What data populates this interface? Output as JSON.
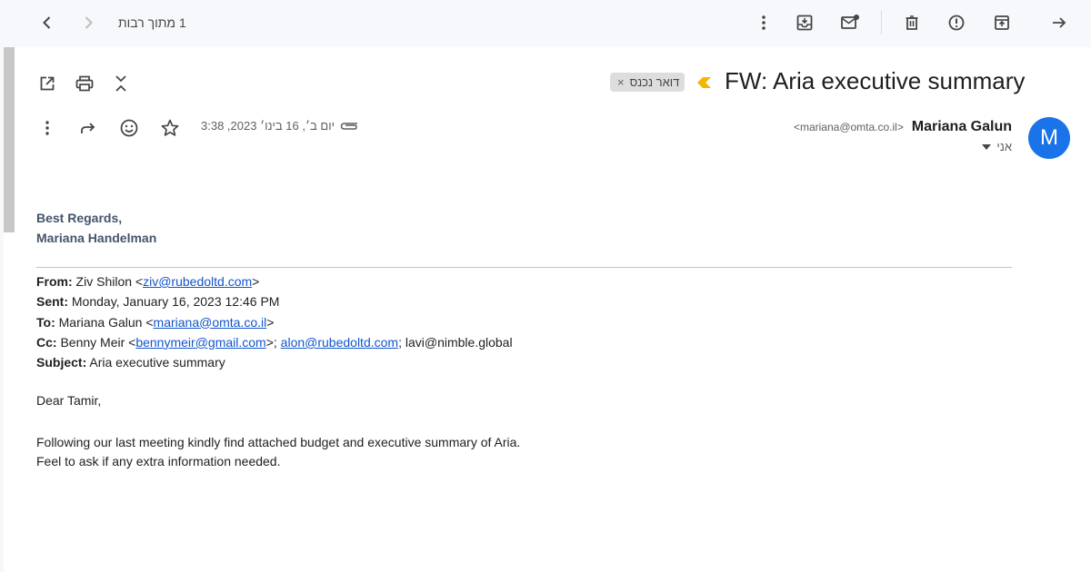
{
  "toolbar": {
    "pager": "1 מתוך רבות",
    "icons": [
      "back-arrow-icon",
      "chevron-left-icon",
      "chevron-right-icon",
      "more-vert-icon",
      "move-to-inbox-icon",
      "mark-unread-icon",
      "delete-icon",
      "report-spam-icon",
      "archive-icon",
      "forward-arrow-icon"
    ]
  },
  "message": {
    "subject": "FW: Aria executive summary",
    "label": "דואר נכנס",
    "label_remove": "×",
    "importance_color": "#f4b400",
    "avatar_letter": "M",
    "avatar_color": "#1a73e8",
    "sender_name": "Mariana Galun",
    "sender_email": "<mariana@omta.co.il>",
    "to_me": "אני",
    "datetime": "יום ב׳, 16 בינו׳ 2023, 3:38"
  },
  "body": {
    "sig_line1": "Best Regards,",
    "sig_line2": "Mariana Handelman",
    "from_label": "From:",
    "from_name": " Ziv Shilon <",
    "from_email": "ziv@rubedoltd.com",
    "from_close": ">",
    "sent_label": "Sent:",
    "sent_value": " Monday, January 16, 2023 12:46 PM",
    "to_label": "To:",
    "to_name": " Mariana Galun <",
    "to_email": "mariana@omta.co.il",
    "to_close": ">",
    "cc_label": "Cc:",
    "cc_name": " Benny Meir <",
    "cc_email1": "bennymeir@gmail.com",
    "cc_sep1": ">; ",
    "cc_email2": "alon@rubedoltd.com",
    "cc_rest": "; lavi@nimble.global",
    "subject_label": "Subject:",
    "subject_value": " Aria executive summary",
    "greeting": "Dear Tamir,",
    "line1": "Following our last meeting kindly find attached budget and executive summary of Aria.",
    "line2": "Feel to ask if any extra information needed."
  }
}
